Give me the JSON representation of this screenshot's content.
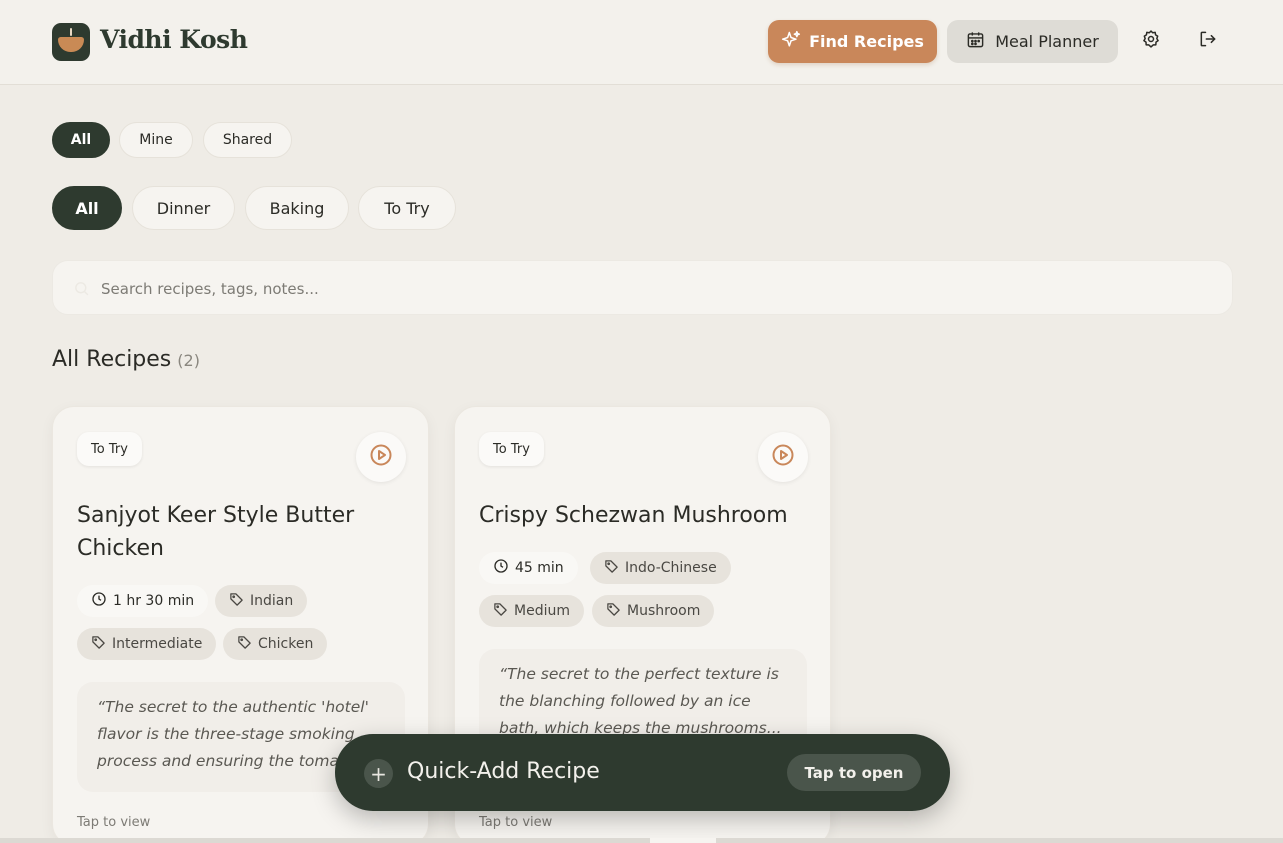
{
  "header": {
    "app_title": "Vidhi Kosh",
    "find_recipes_label": "Find Recipes",
    "meal_planner_label": "Meal Planner"
  },
  "ownership_filters": [
    {
      "label": "All",
      "active": true
    },
    {
      "label": "Mine",
      "active": false
    },
    {
      "label": "Shared",
      "active": false
    }
  ],
  "collection_filters": [
    {
      "label": "All",
      "active": true
    },
    {
      "label": "Dinner",
      "active": false
    },
    {
      "label": "Baking",
      "active": false
    },
    {
      "label": "To Try",
      "active": false
    }
  ],
  "search": {
    "placeholder": "Search recipes, tags, notes...",
    "value": ""
  },
  "section": {
    "title": "All Recipes",
    "count": "(2)"
  },
  "recipes": [
    {
      "badge": "To Try",
      "title": "Sanjyot Keer Style Butter Chicken",
      "time": "1 hr 30 min",
      "tags": [
        "Indian",
        "Intermediate",
        "Chicken"
      ],
      "note": "“The secret to the authentic 'hotel' flavor is the three-stage smoking process and ensuring the toma",
      "tap_label": "Tap to view"
    },
    {
      "badge": "To Try",
      "title": "Crispy Schezwan Mushroom",
      "time": "45 min",
      "tags": [
        "Indo-Chinese",
        "Medium",
        "Mushroom"
      ],
      "note": "“The secret to the perfect texture is the blanching followed by an ice bath, which keeps the mushrooms...",
      "tap_label": "Tap to view"
    }
  ],
  "quick_add": {
    "label": "Quick-Add Recipe",
    "open_label": "Tap to open"
  },
  "colors": {
    "accent": "#c9875a",
    "primary_dark": "#2e3a2f",
    "background": "#efece6"
  }
}
